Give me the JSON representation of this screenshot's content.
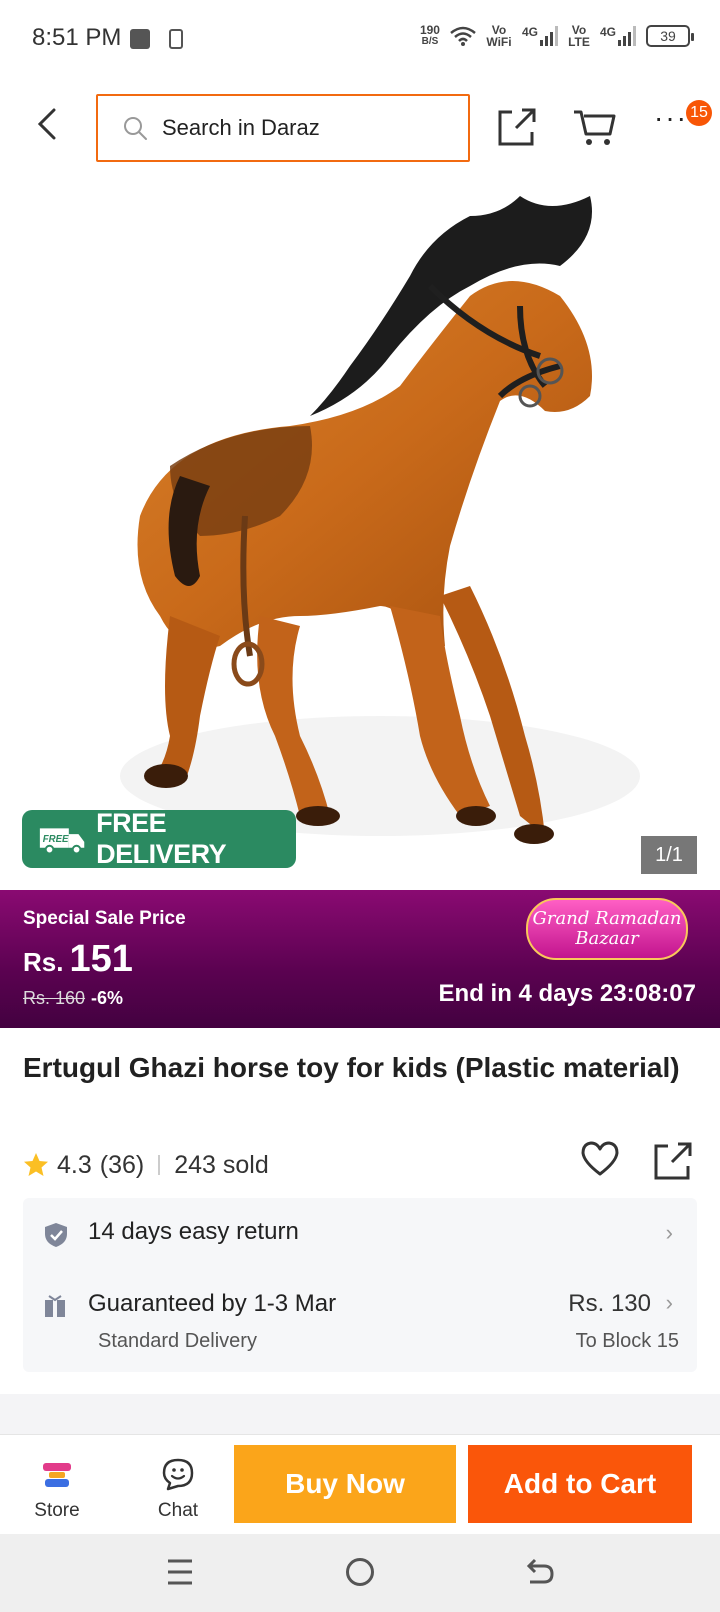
{
  "status_bar": {
    "time": "8:51 PM",
    "net_speed": "190",
    "net_unit": "B/S",
    "vo_wifi": "Vo WiFi",
    "sig1": "4G",
    "vo_lte": "Vo LTE",
    "sig2": "4G",
    "battery": "39"
  },
  "header": {
    "search_placeholder": "Search in Daraz",
    "cart_badge": "15"
  },
  "gallery": {
    "free_delivery": "FREE DELIVERY",
    "free_tag": "FREE",
    "counter": "1/1"
  },
  "sale": {
    "label": "Special Sale Price",
    "currency": "Rs.",
    "price": "151",
    "original_price": "Rs. 160",
    "discount": "-6%",
    "bazaar_line1": "Grand Ramadan",
    "bazaar_line2": "Bazaar",
    "countdown": "End in 4 days 23:08:07"
  },
  "product": {
    "title": "Ertugul Ghazi horse toy for kids (Plastic material)",
    "rating": "4.3",
    "reviews": "(36)",
    "sold": "243 sold"
  },
  "delivery": {
    "return_text": "14 days easy return",
    "guarantee_text": "Guaranteed by 1-3 Mar",
    "delivery_type": "Standard Delivery",
    "delivery_price": "Rs. 130",
    "destination": "To Block 15"
  },
  "actions": {
    "store_label": "Store",
    "chat_label": "Chat",
    "buy_now": "Buy Now",
    "add_to_cart": "Add to Cart"
  },
  "colors": {
    "accent_orange": "#f85606",
    "buy_now_yellow": "#fba51a",
    "free_delivery_green": "#2b8a61",
    "sale_purple": "#6a0560"
  }
}
